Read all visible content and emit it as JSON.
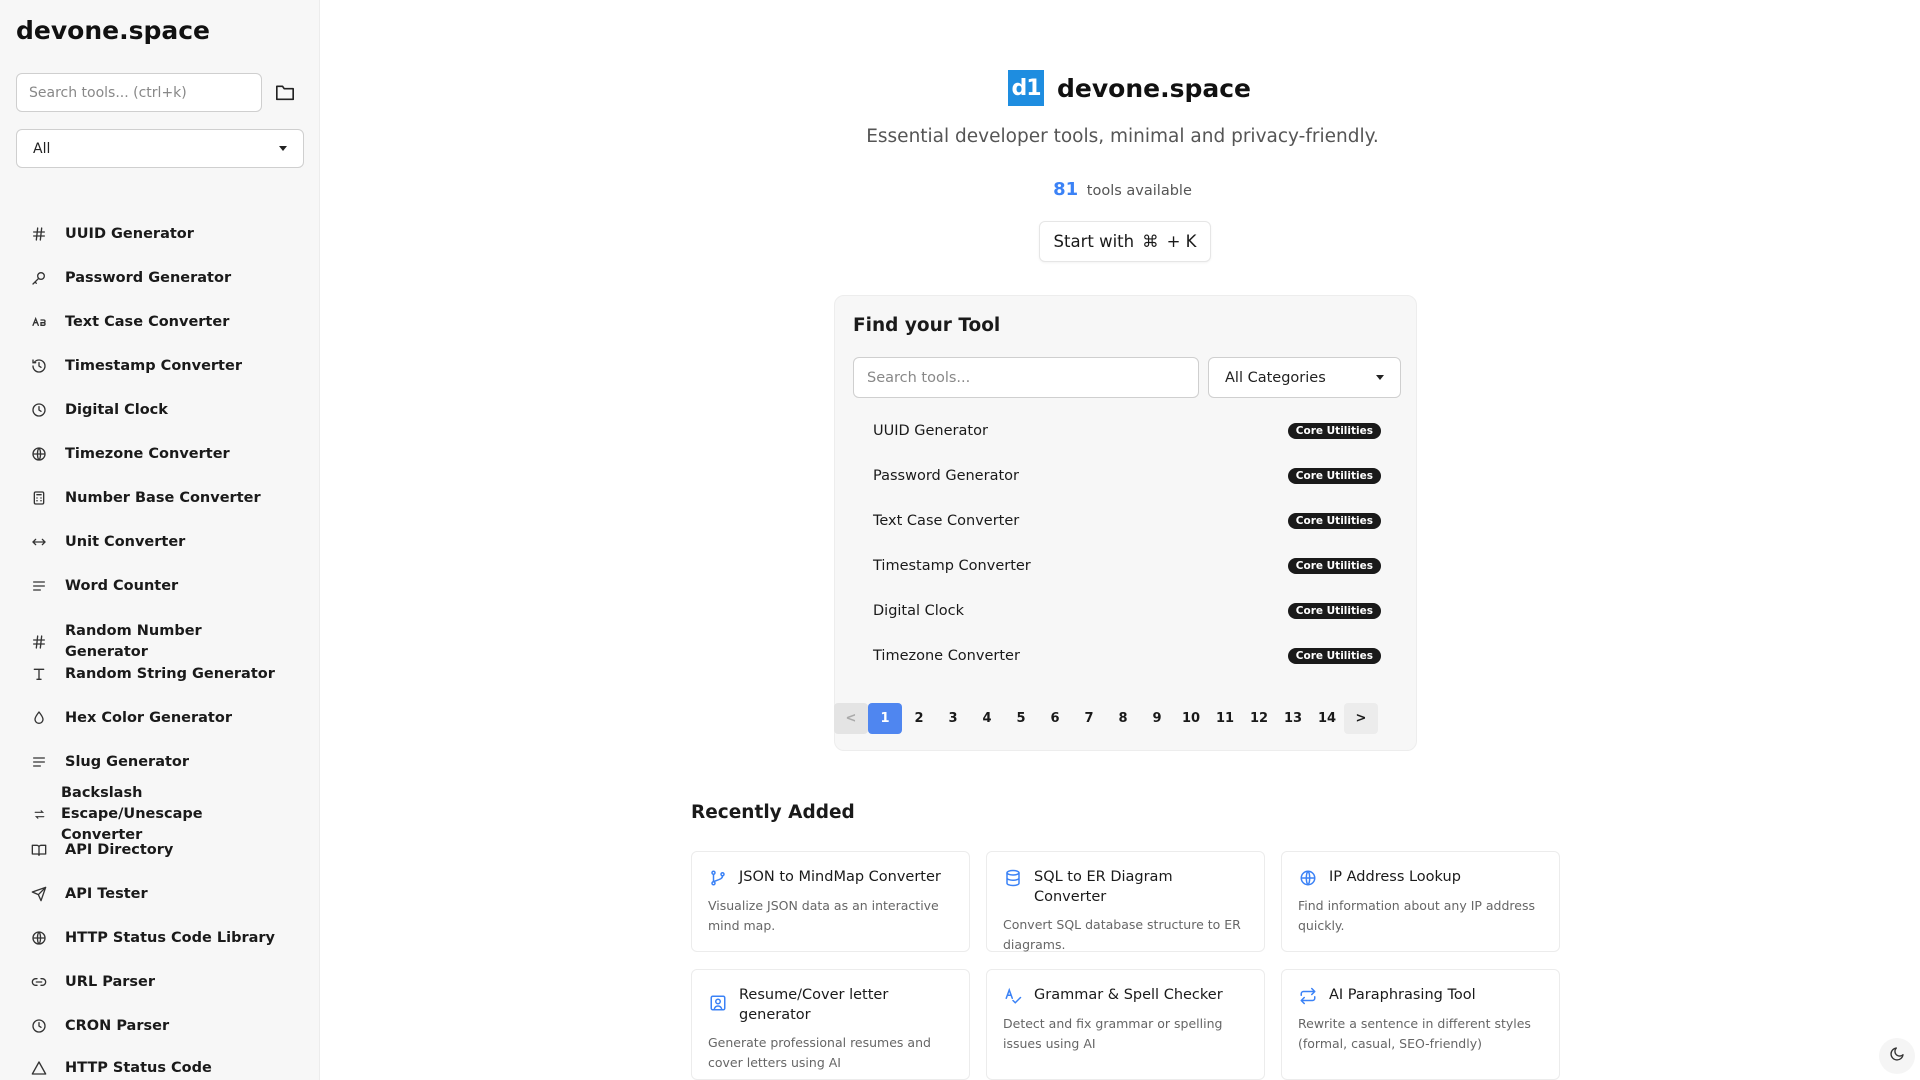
{
  "sidebar": {
    "brand": "devone.space",
    "search_placeholder": "Search tools... (ctrl+k)",
    "category_select": "All",
    "items": [
      {
        "label": "UUID Generator",
        "icon": "hash-icon"
      },
      {
        "label": "Password Generator",
        "icon": "key-icon"
      },
      {
        "label": "Text Case Converter",
        "icon": "case-icon"
      },
      {
        "label": "Timestamp Converter",
        "icon": "history-icon"
      },
      {
        "label": "Digital Clock",
        "icon": "clock-icon"
      },
      {
        "label": "Timezone Converter",
        "icon": "globe-icon"
      },
      {
        "label": "Number Base Converter",
        "icon": "calculator-icon"
      },
      {
        "label": "Unit Converter",
        "icon": "arrows-horizontal-icon"
      },
      {
        "label": "Word Counter",
        "icon": "align-left-icon"
      },
      {
        "label": "Random Number Generator",
        "icon": "hash-icon"
      },
      {
        "label": "Random String Generator",
        "icon": "type-icon"
      },
      {
        "label": "Hex Color Generator",
        "icon": "droplet-icon"
      },
      {
        "label": "Slug Generator",
        "icon": "align-left-icon"
      },
      {
        "label": "Backslash Escape/Unescape Converter",
        "icon": "swap-icon"
      },
      {
        "label": "API Directory",
        "icon": "book-icon"
      },
      {
        "label": "API Tester",
        "icon": "send-icon"
      },
      {
        "label": "HTTP Status Code Library",
        "icon": "globe-icon"
      },
      {
        "label": "URL Parser",
        "icon": "link-icon"
      },
      {
        "label": "CRON Parser",
        "icon": "clock-icon"
      },
      {
        "label": "HTTP Status Code",
        "icon": "warning-icon"
      }
    ]
  },
  "hero": {
    "logo_text": "d1",
    "title": "devone.space",
    "tagline": "Essential developer tools, minimal and privacy-friendly.",
    "tools_count": "81",
    "tools_label": "tools available",
    "start_prefix": "Start with",
    "start_key": "⌘",
    "start_suffix": "+ K"
  },
  "finder": {
    "title": "Find your Tool",
    "search_placeholder": "Search tools...",
    "category_select": "All Categories",
    "rows": [
      {
        "name": "UUID Generator",
        "badge": "Core Utilities"
      },
      {
        "name": "Password Generator",
        "badge": "Core Utilities"
      },
      {
        "name": "Text Case Converter",
        "badge": "Core Utilities"
      },
      {
        "name": "Timestamp Converter",
        "badge": "Core Utilities"
      },
      {
        "name": "Digital Clock",
        "badge": "Core Utilities"
      },
      {
        "name": "Timezone Converter",
        "badge": "Core Utilities"
      }
    ],
    "pagination": {
      "prev": "<",
      "next": ">",
      "pages": [
        "1",
        "2",
        "3",
        "4",
        "5",
        "6",
        "7",
        "8",
        "9",
        "10",
        "11",
        "12",
        "13",
        "14"
      ],
      "current": "1"
    }
  },
  "recent": {
    "title": "Recently Added",
    "cards": [
      {
        "title": "JSON to MindMap Converter",
        "desc": "Visualize JSON data as an interactive mind map.",
        "icon": "git-branch-icon"
      },
      {
        "title": "SQL to ER Diagram Converter",
        "desc": "Convert SQL database structure to ER diagrams.",
        "icon": "database-icon"
      },
      {
        "title": "IP Address Lookup",
        "desc": "Find information about any IP address quickly.",
        "icon": "globe-icon"
      },
      {
        "title": "Resume/Cover letter generator",
        "desc": "Generate professional resumes and cover letters using AI",
        "icon": "user-square-icon"
      },
      {
        "title": "Grammar & Spell Checker",
        "desc": "Detect and fix grammar or spelling issues using AI",
        "icon": "spell-check-icon"
      },
      {
        "title": "AI Paraphrasing Tool",
        "desc": "Rewrite a sentence in different styles (formal, casual, SEO-friendly)",
        "icon": "repeat-icon"
      }
    ]
  },
  "colors": {
    "accent": "#3b82f6",
    "logo": "#1e8de0",
    "badge": "#1a1a1a",
    "card_icon": "#3b82f6"
  }
}
